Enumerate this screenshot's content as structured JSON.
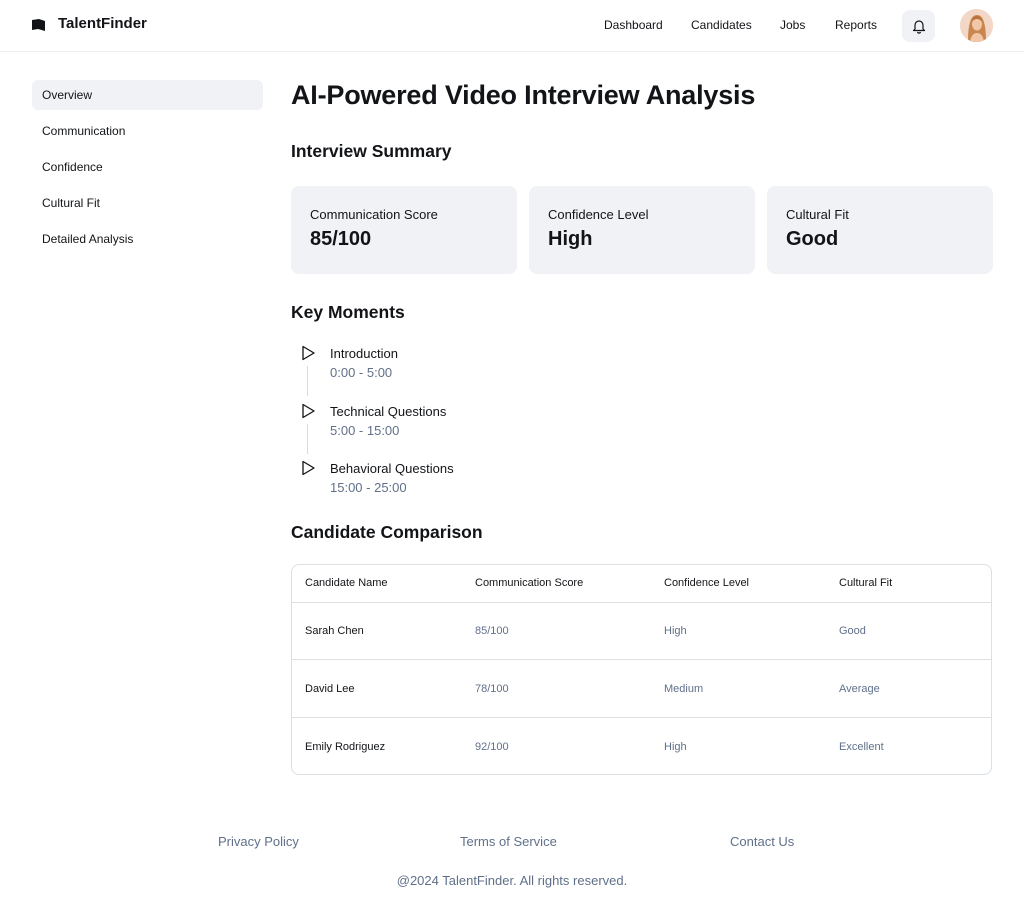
{
  "header": {
    "brand": "TalentFinder",
    "nav": [
      "Dashboard",
      "Candidates",
      "Jobs",
      "Reports"
    ]
  },
  "sidebar": {
    "items": [
      {
        "label": "Overview",
        "active": true
      },
      {
        "label": "Communication",
        "active": false
      },
      {
        "label": "Confidence",
        "active": false
      },
      {
        "label": "Cultural Fit",
        "active": false
      },
      {
        "label": "Detailed Analysis",
        "active": false
      }
    ]
  },
  "main": {
    "title": "AI-Powered Video Interview Analysis",
    "summary_title": "Interview Summary",
    "cards": [
      {
        "label": "Communication Score",
        "value": "85/100"
      },
      {
        "label": "Confidence Level",
        "value": "High"
      },
      {
        "label": "Cultural Fit",
        "value": "Good"
      }
    ],
    "moments_title": "Key Moments",
    "moments": [
      {
        "title": "Introduction",
        "time": "0:00 - 5:00"
      },
      {
        "title": "Technical Questions",
        "time": "5:00 - 15:00"
      },
      {
        "title": "Behavioral Questions",
        "time": "15:00 - 25:00"
      }
    ],
    "comparison_title": "Candidate Comparison",
    "table": {
      "headers": [
        "Candidate Name",
        "Communication Score",
        "Confidence Level",
        "Cultural Fit"
      ],
      "rows": [
        [
          "Sarah Chen",
          "85/100",
          "High",
          "Good"
        ],
        [
          "David Lee",
          "78/100",
          "Medium",
          "Average"
        ],
        [
          "Emily Rodriguez",
          "92/100",
          "High",
          "Excellent"
        ]
      ]
    }
  },
  "footer": {
    "links": [
      "Privacy Policy",
      "Terms of Service",
      "Contact Us"
    ],
    "copyright": "@2024 TalentFinder. All rights reserved."
  },
  "colors": {
    "text": "#121417",
    "muted": "#60708a",
    "surface": "#f0f2f5",
    "border": "#dbe0e5"
  },
  "icons": {
    "logo": "logo-icon",
    "bell": "bell-icon",
    "play": "play-icon"
  }
}
